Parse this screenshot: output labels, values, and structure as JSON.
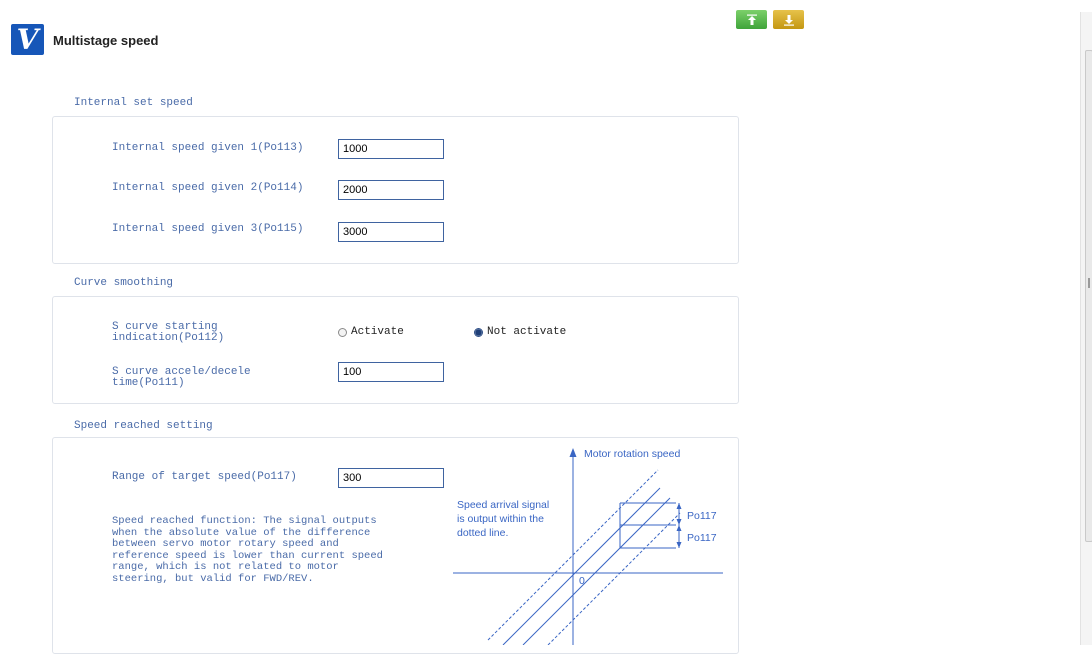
{
  "header": {
    "logo_text": "V",
    "title": "Multistage speed"
  },
  "toolbar": {
    "upload_icon": "upload-arrow-icon",
    "download_icon": "download-arrow-icon"
  },
  "internal_speed": {
    "title": "Internal set speed",
    "fields": [
      {
        "label": "Internal speed given 1(Po113)",
        "value": "1000"
      },
      {
        "label": "Internal speed given 2(Po114)",
        "value": "2000"
      },
      {
        "label": "Internal speed given 3(Po115)",
        "value": "3000"
      }
    ]
  },
  "curve_smoothing": {
    "title": "Curve smoothing",
    "s_curve_indication": {
      "label": "S curve starting\nindication(Po112)",
      "options": [
        "Activate",
        "Not activate"
      ],
      "selected": "Not activate"
    },
    "s_curve_time": {
      "label": "S curve accele/decele\ntime(Po111)",
      "value": "100"
    }
  },
  "speed_reached": {
    "title": "Speed reached setting",
    "range_label": "Range of target speed(Po117)",
    "range_value": "300",
    "description": "Speed reached function: The signal outputs\nwhen the absolute value of the difference\nbetween servo motor rotary speed and\nreference speed is lower than current speed\nrange, which is not related to motor\nsteering, but valid for FWD/REV.",
    "diagram": {
      "axis_label": "Motor rotation speed",
      "note": "Speed arrival signal\nis output within the\ndotted line.",
      "upper_label": "Po117",
      "lower_label": "Po117",
      "origin_label": "0"
    }
  },
  "colors": {
    "accent": "#1656b8",
    "label": "#4a6ba8",
    "diagram": "#3a66c4"
  }
}
